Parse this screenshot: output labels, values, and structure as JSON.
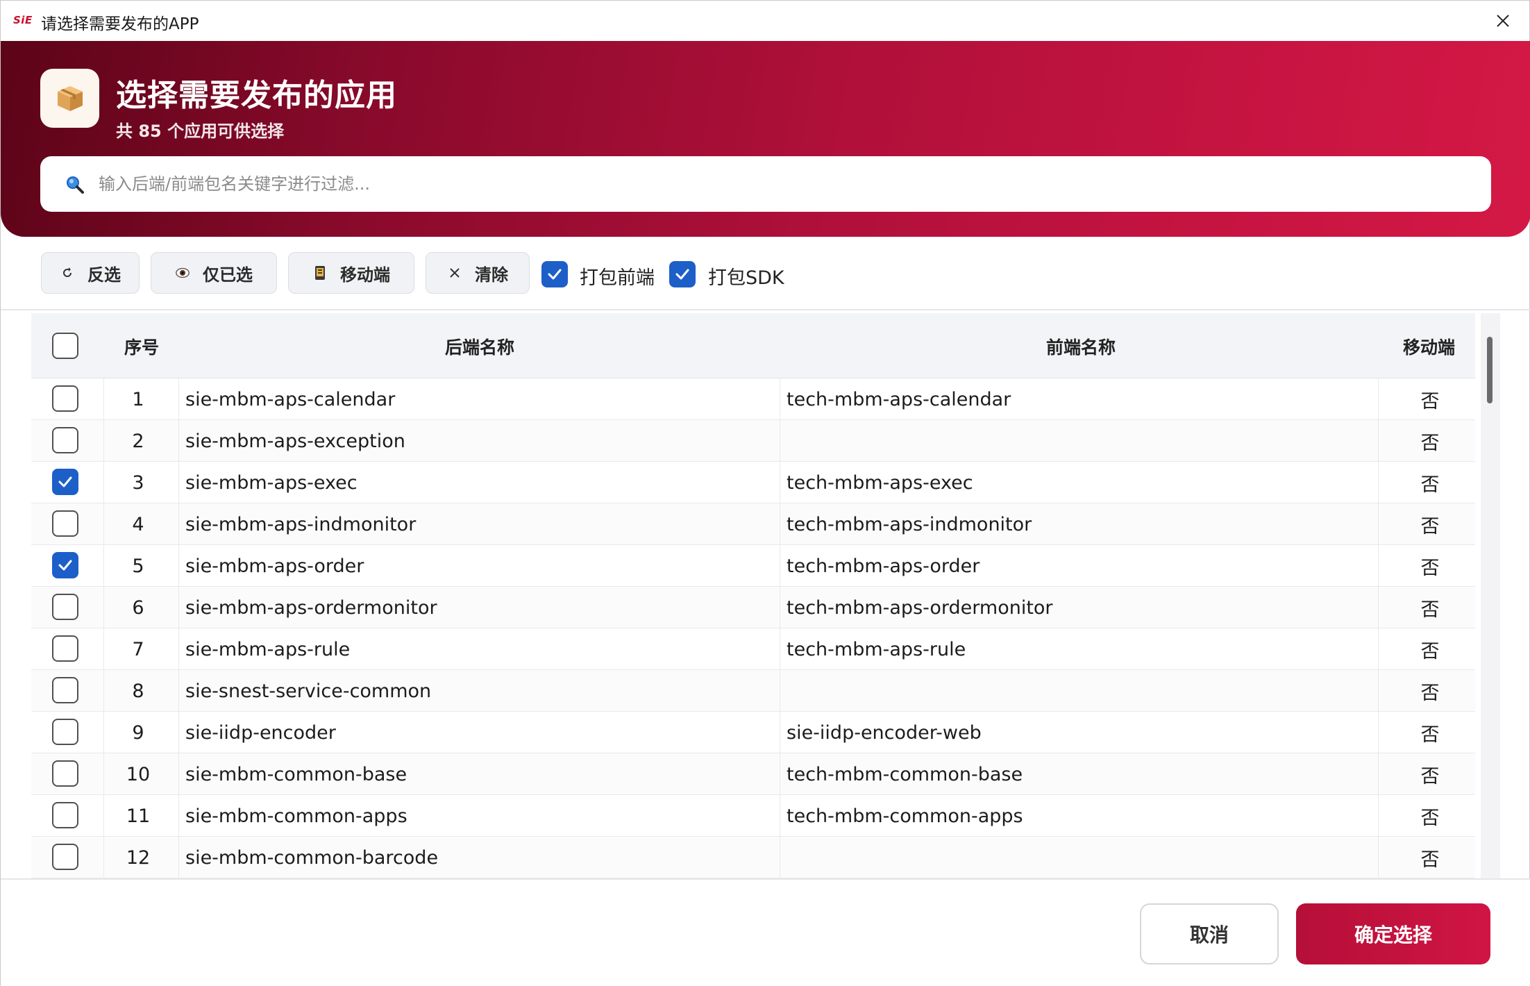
{
  "window": {
    "logo_text": "SiE",
    "title": "请选择需要发布的APP"
  },
  "header": {
    "icon": "package-box-icon",
    "title": "选择需要发布的应用",
    "subtitle": "共 85 个应用可供选择"
  },
  "search": {
    "placeholder": "输入后端/前端包名关键字进行过滤...",
    "value": ""
  },
  "toolbar": {
    "invert_label": "反选",
    "only_selected_label": "仅已选",
    "mobile_label": "移动端",
    "clear_label": "清除",
    "pack_frontend": {
      "label": "打包前端",
      "checked": true
    },
    "pack_sdk": {
      "label": "打包SDK",
      "checked": true
    }
  },
  "table": {
    "headers": {
      "select_all": false,
      "index": "序号",
      "backend": "后端名称",
      "frontend": "前端名称",
      "mobile": "移动端"
    },
    "rows": [
      {
        "checked": false,
        "index": "1",
        "backend": "sie-mbm-aps-calendar",
        "frontend": "tech-mbm-aps-calendar",
        "mobile": "否"
      },
      {
        "checked": false,
        "index": "2",
        "backend": "sie-mbm-aps-exception",
        "frontend": "",
        "mobile": "否"
      },
      {
        "checked": true,
        "index": "3",
        "backend": "sie-mbm-aps-exec",
        "frontend": "tech-mbm-aps-exec",
        "mobile": "否"
      },
      {
        "checked": false,
        "index": "4",
        "backend": "sie-mbm-aps-indmonitor",
        "frontend": "tech-mbm-aps-indmonitor",
        "mobile": "否"
      },
      {
        "checked": true,
        "index": "5",
        "backend": "sie-mbm-aps-order",
        "frontend": "tech-mbm-aps-order",
        "mobile": "否"
      },
      {
        "checked": false,
        "index": "6",
        "backend": "sie-mbm-aps-ordermonitor",
        "frontend": "tech-mbm-aps-ordermonitor",
        "mobile": "否"
      },
      {
        "checked": false,
        "index": "7",
        "backend": "sie-mbm-aps-rule",
        "frontend": "tech-mbm-aps-rule",
        "mobile": "否"
      },
      {
        "checked": false,
        "index": "8",
        "backend": "sie-snest-service-common",
        "frontend": "",
        "mobile": "否"
      },
      {
        "checked": false,
        "index": "9",
        "backend": "sie-iidp-encoder",
        "frontend": "sie-iidp-encoder-web",
        "mobile": "否"
      },
      {
        "checked": false,
        "index": "10",
        "backend": "sie-mbm-common-base",
        "frontend": "tech-mbm-common-base",
        "mobile": "否"
      },
      {
        "checked": false,
        "index": "11",
        "backend": "sie-mbm-common-apps",
        "frontend": "tech-mbm-common-apps",
        "mobile": "否"
      },
      {
        "checked": false,
        "index": "12",
        "backend": "sie-mbm-common-barcode",
        "frontend": "",
        "mobile": "否"
      }
    ]
  },
  "footer": {
    "cancel_label": "取消",
    "confirm_label": "确定选择"
  },
  "colors": {
    "brand": "#c8102e",
    "header_gradient_start": "#5c0418",
    "header_gradient_end": "#d41845",
    "checkbox_checked": "#1d5fc8",
    "confirm_button": "#c3123f"
  }
}
